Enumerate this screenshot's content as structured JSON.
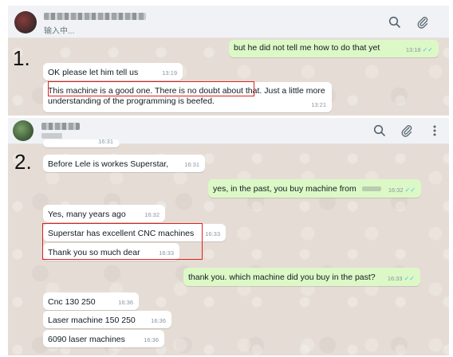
{
  "steps": {
    "one": "1.",
    "two": "2."
  },
  "panel1": {
    "header": {
      "status": "输入中..."
    },
    "messages": [
      {
        "text": "but he did not tell me how to do that yet",
        "time": "13:18",
        "dir": "out"
      },
      {
        "text": "OK please let him tell us",
        "time": "13:19",
        "dir": "in"
      },
      {
        "text_a": "This machine is a good one. There is no doubt about that.",
        "text_b": " Just a little more",
        "text_c": "understanding of the programming is beefed.",
        "time": "13:21",
        "dir": "in"
      }
    ]
  },
  "panel2": {
    "messages": [
      {
        "text": "16:31",
        "time": "",
        "dir": "in"
      },
      {
        "text": "Before Lele is workes Superstar,",
        "time": "16:31",
        "dir": "in"
      },
      {
        "text": "yes, in the past, you buy machine from",
        "time": "16:32",
        "dir": "out"
      },
      {
        "text": "Yes, many years ago",
        "time": "16:32",
        "dir": "in"
      },
      {
        "text": "Superstar has excellent CNC machines",
        "time": "16:33",
        "dir": "in"
      },
      {
        "text": "Thank you so much dear",
        "time": "16:33",
        "dir": "in"
      },
      {
        "text": "thank you. which machine did you buy in the past?",
        "time": "16:33",
        "dir": "out"
      },
      {
        "text": "Cnc 130 250",
        "time": "16:36",
        "dir": "in"
      },
      {
        "text": "Laser machine 150 250",
        "time": "16:36",
        "dir": "in"
      },
      {
        "text": "6090 laser machines",
        "time": "16:36",
        "dir": "in"
      }
    ]
  },
  "icons": {
    "search": "search-icon",
    "attach": "paperclip-icon",
    "menu": "menu-dots-icon"
  },
  "colors": {
    "incoming": "#ffffff",
    "outgoing": "#dcf8c6",
    "chat_bg": "#e5ddd5",
    "header_bg": "#f0f2f5",
    "read_ticks": "#53bdeb",
    "highlight": "#e02020"
  }
}
